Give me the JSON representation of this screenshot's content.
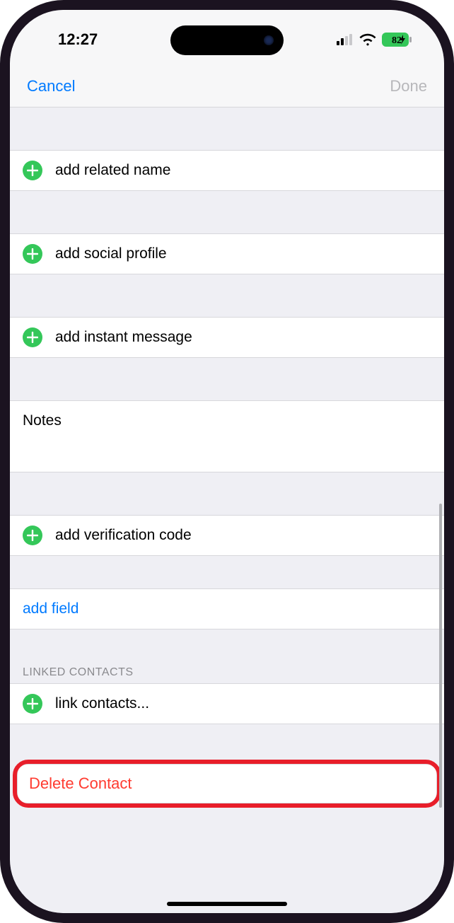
{
  "status": {
    "time": "12:27",
    "battery_text": "82"
  },
  "nav": {
    "cancel": "Cancel",
    "done": "Done"
  },
  "rows": {
    "related_name": "add related name",
    "social_profile": "add social profile",
    "instant_message": "add instant message",
    "notes_label": "Notes",
    "verification_code": "add verification code",
    "add_field": "add field",
    "linked_header": "LINKED CONTACTS",
    "link_contacts": "link contacts...",
    "delete_contact": "Delete Contact"
  }
}
